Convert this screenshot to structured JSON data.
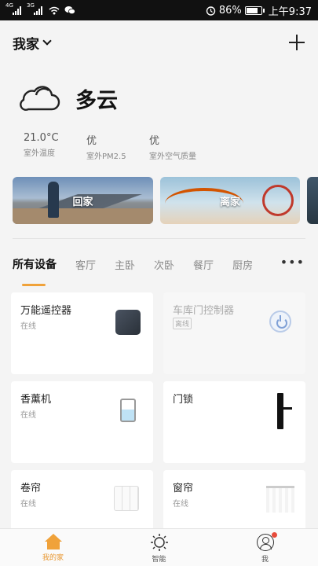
{
  "status_bar": {
    "signal1": "4G",
    "signal2": "3G",
    "battery": "86%",
    "time": "上午9:37",
    "battery_level": 0.86
  },
  "header": {
    "home_name": "我家"
  },
  "weather": {
    "condition": "多云",
    "metrics": [
      {
        "value": "21.0°C",
        "label": "室外温度"
      },
      {
        "value": "优",
        "label": "室外PM2.5"
      },
      {
        "value": "优",
        "label": "室外空气质量"
      }
    ]
  },
  "scenes": [
    {
      "label": "回家"
    },
    {
      "label": "离家"
    }
  ],
  "tabs": [
    "所有设备",
    "客厅",
    "主卧",
    "次卧",
    "餐厅",
    "厨房"
  ],
  "tab_more": "•••",
  "devices": [
    {
      "name": "万能遥控器",
      "status": "在线",
      "icon": "remote-icon"
    },
    {
      "name": "车库门控制器",
      "status": "离线",
      "icon": "power-icon"
    },
    {
      "name": "香薰机",
      "status": "在线",
      "icon": "aroma-diffuser-icon"
    },
    {
      "name": "门锁",
      "status": "",
      "icon": "door-lock-icon"
    },
    {
      "name": "卷帘",
      "status": "在线",
      "icon": "roller-blind-icon"
    },
    {
      "name": "窗帘",
      "status": "在线",
      "icon": "curtain-icon"
    }
  ],
  "bottom_nav": [
    {
      "label": "我的家",
      "icon": "home-icon",
      "active": true
    },
    {
      "label": "智能",
      "icon": "sun-icon",
      "active": false
    },
    {
      "label": "我",
      "icon": "profile-icon",
      "active": false
    }
  ],
  "colors": {
    "accent": "#f0a23a",
    "offline_badge": "#cccccc",
    "notification_dot": "#e74c3c"
  }
}
